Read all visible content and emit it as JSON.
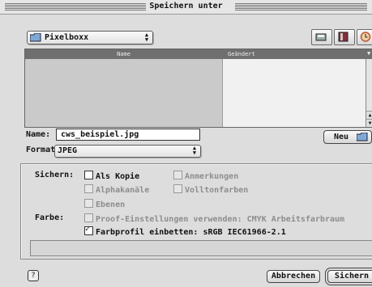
{
  "window": {
    "title": "Speichern unter"
  },
  "location": {
    "folder": "Pixelboxx"
  },
  "toolbar": {
    "icons": [
      "disk-icon",
      "book-icon",
      "clock-icon"
    ]
  },
  "file_list": {
    "columns": [
      "Name",
      "Geändert"
    ],
    "rows": []
  },
  "name_field": {
    "label": "Name:",
    "value": "cws_beispiel.jpg"
  },
  "new_folder_button": {
    "label": "Neu"
  },
  "format": {
    "label": "Format:",
    "value": "JPEG"
  },
  "save_options": {
    "label": "Sichern:",
    "options": [
      {
        "label": "Als Kopie",
        "checked": false,
        "enabled": true
      },
      {
        "label": "Anmerkungen",
        "checked": false,
        "enabled": false
      },
      {
        "label": "Alphakanäle",
        "checked": false,
        "enabled": false
      },
      {
        "label": "Volltonfarben",
        "checked": false,
        "enabled": false
      },
      {
        "label": "Ebenen",
        "checked": false,
        "enabled": false
      }
    ]
  },
  "color": {
    "label": "Farbe:",
    "proof": {
      "label": "Proof-Einstellungen verwenden: CMYK Arbeitsfarbraum",
      "checked": false,
      "enabled": false
    },
    "profile": {
      "label": "Farbprofil einbetten: sRGB IEC61966-2.1",
      "checked": true,
      "enabled": true
    }
  },
  "buttons": {
    "cancel": "Abbrechen",
    "save": "Sichern"
  },
  "help": {
    "label": "?"
  }
}
